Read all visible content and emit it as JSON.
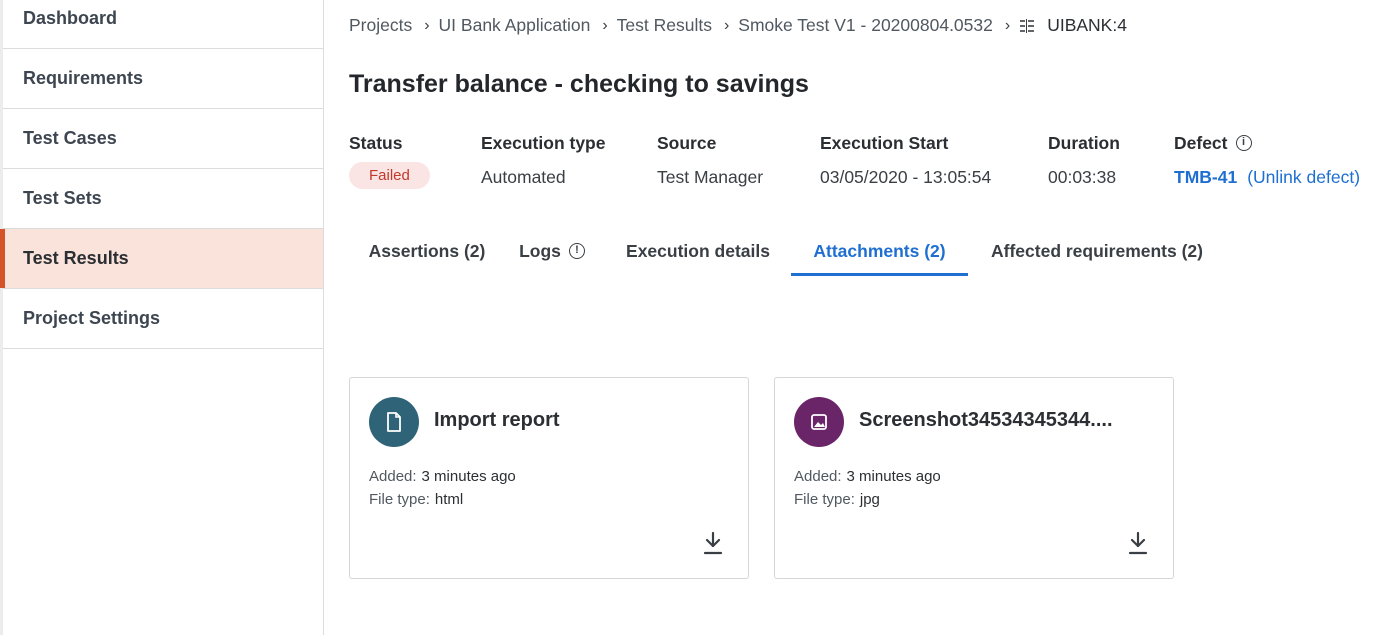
{
  "sidebar": {
    "items": [
      {
        "label": "Dashboard"
      },
      {
        "label": "Requirements"
      },
      {
        "label": "Test Cases"
      },
      {
        "label": "Test Sets"
      },
      {
        "label": "Test Results",
        "active": true
      },
      {
        "label": "Project Settings"
      }
    ]
  },
  "breadcrumb": {
    "items": [
      "Projects",
      "UI Bank Application",
      "Test Results",
      "Smoke Test V1 - 20200804.0532"
    ],
    "current": "UIBANK:4",
    "current_icon": "test-result-list-icon"
  },
  "page": {
    "title": "Transfer balance - checking to savings"
  },
  "meta": {
    "status": {
      "label": "Status",
      "value": "Failed"
    },
    "execution_type": {
      "label": "Execution type",
      "value": "Automated"
    },
    "source": {
      "label": "Source",
      "value": "Test Manager"
    },
    "execution_start": {
      "label": "Execution Start",
      "value": "03/05/2020 - 13:05:54"
    },
    "duration": {
      "label": "Duration",
      "value": "00:03:38"
    },
    "defect": {
      "label": "Defect",
      "value": "TMB-41",
      "action": "(Unlink defect)"
    }
  },
  "tabs": [
    {
      "label": "Assertions (2)"
    },
    {
      "label": "Logs"
    },
    {
      "label": "Execution details"
    },
    {
      "label": "Attachments (2)",
      "active": true
    },
    {
      "label": "Affected requirements (2)"
    }
  ],
  "attachments": [
    {
      "title": "Import report",
      "added_label": "Added:",
      "added": "3 minutes ago",
      "type_label": "File type:",
      "type": "html",
      "icon": "document-icon",
      "color": "#2e6378"
    },
    {
      "title": "Screenshot34534345344....",
      "added_label": "Added:",
      "added": "3 minutes ago",
      "type_label": "File type:",
      "type": "jpg",
      "icon": "image-icon",
      "color": "#6a2468"
    }
  ],
  "colors": {
    "accent": "#1f6fd1",
    "active_nav": "#d4532a",
    "active_nav_bg": "#f9e3db",
    "failed": "#c0392b"
  }
}
